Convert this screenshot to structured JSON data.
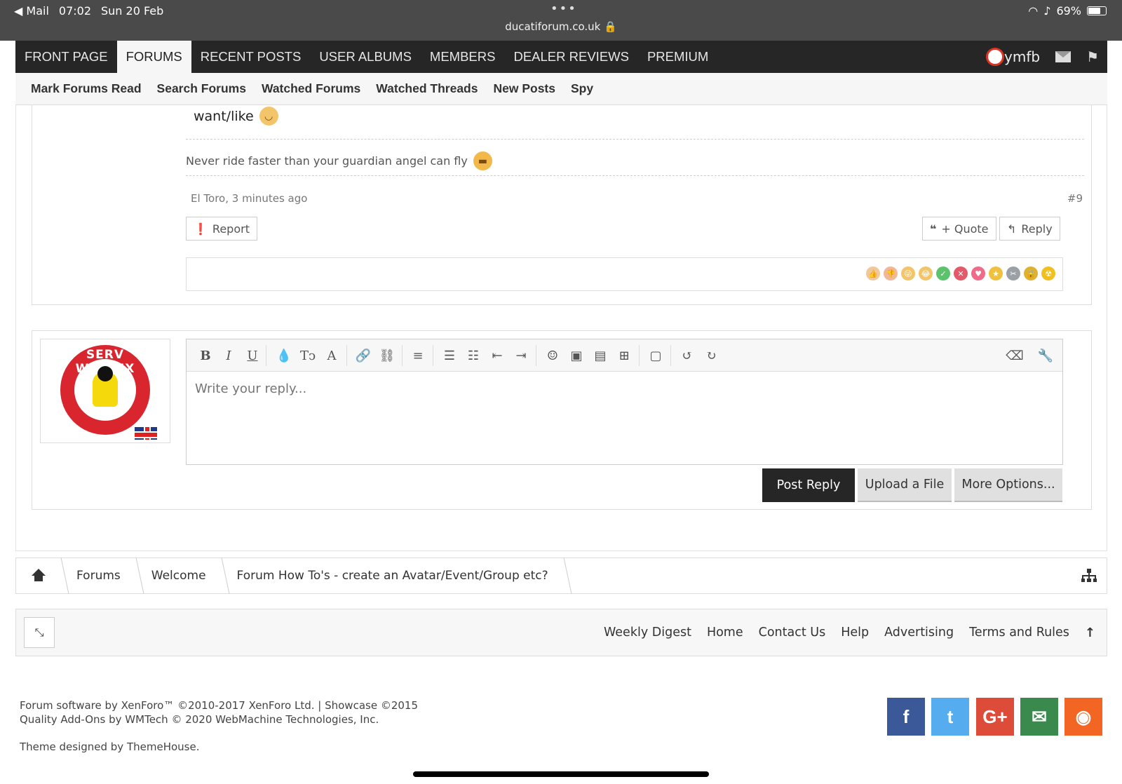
{
  "status_bar": {
    "back_app": "◀ Mail",
    "time": "07:02",
    "date": "Sun 20 Feb",
    "dots": "•••",
    "url": "ducatiforum.co.uk 🔒",
    "battery": "69%",
    "battery_level": 0.69
  },
  "nav": {
    "tabs": [
      "FRONT PAGE",
      "FORUMS",
      "RECENT POSTS",
      "USER ALBUMS",
      "MEMBERS",
      "DEALER REVIEWS",
      "PREMIUM"
    ],
    "active_tab": "FORUMS",
    "username": "ymfb"
  },
  "subnav": [
    "Mark Forums Read",
    "Search Forums",
    "Watched Forums",
    "Watched Threads",
    "New Posts",
    "Spy"
  ],
  "post": {
    "text_tail": "want/like",
    "signature": "Never ride faster than your guardian angel can fly",
    "author_time": "El Toro, 3 minutes ago",
    "post_number": "#9",
    "report_label": "Report",
    "quote_label": "+ Quote",
    "reply_label": "Reply",
    "reactions": [
      {
        "icon": "thumbs-up-icon",
        "color": "#f0c89a",
        "glyph": "👍"
      },
      {
        "icon": "thumbs-down-icon",
        "color": "#f0b899",
        "glyph": "👎"
      },
      {
        "icon": "tongue-face-icon",
        "color": "#f3c56a",
        "glyph": "😜"
      },
      {
        "icon": "laughing-face-icon",
        "color": "#f3c56a",
        "glyph": "😂"
      },
      {
        "icon": "check-icon",
        "color": "#5cc26b",
        "glyph": "✓"
      },
      {
        "icon": "cross-icon",
        "color": "#e25a6a",
        "glyph": "✕"
      },
      {
        "icon": "heart-icon",
        "color": "#f06b8a",
        "glyph": "♥"
      },
      {
        "icon": "medal-icon",
        "color": "#f0c040",
        "glyph": "★"
      },
      {
        "icon": "tools-icon",
        "color": "#9aa0a6",
        "glyph": "✂"
      },
      {
        "icon": "lock-icon",
        "color": "#e0b030",
        "glyph": "🔒"
      },
      {
        "icon": "radioactive-icon",
        "color": "#f0c020",
        "glyph": "☢"
      }
    ]
  },
  "editor": {
    "placeholder": "Write your reply...",
    "toolbar": [
      "bold-icon",
      "italic-icon",
      "underline-icon",
      "text-color-icon",
      "font-size-icon",
      "font-family-icon",
      "link-icon",
      "unlink-icon",
      "align-icon",
      "bullet-list-icon",
      "numbered-list-icon",
      "outdent-icon",
      "indent-icon",
      "smilies-icon",
      "image-icon",
      "media-icon",
      "insert-icon",
      "save-draft-icon",
      "undo-icon",
      "redo-icon",
      "remove-format-icon",
      "bbcode-toggle-icon"
    ],
    "post_reply": "Post Reply",
    "upload_file": "Upload a File",
    "more_options": "More Options..."
  },
  "avatar": {
    "text": "SERV WESSEX"
  },
  "breadcrumb": [
    "Forums",
    "Welcome",
    "Forum How To's - create an Avatar/Event/Group etc?"
  ],
  "footer": {
    "links": [
      "Weekly Digest",
      "Home",
      "Contact Us",
      "Help",
      "Advertising",
      "Terms and Rules"
    ],
    "copyright_1": "Forum software by XenForo™ ©2010-2017 XenForo Ltd. | Showcase ©2015",
    "copyright_2": "Quality Add-Ons by WMTech © 2020 WebMachine Technologies, Inc.",
    "theme": "Theme designed by ThemeHouse.",
    "social": [
      {
        "name": "facebook-icon",
        "glyph": "f",
        "color": "#3b5998"
      },
      {
        "name": "twitter-icon",
        "glyph": "t",
        "color": "#55acee"
      },
      {
        "name": "google-plus-icon",
        "glyph": "G+",
        "color": "#dd4b39"
      },
      {
        "name": "email-icon",
        "glyph": "✉",
        "color": "#3a8a4d"
      },
      {
        "name": "rss-icon",
        "glyph": "◉",
        "color": "#f26522"
      }
    ]
  }
}
